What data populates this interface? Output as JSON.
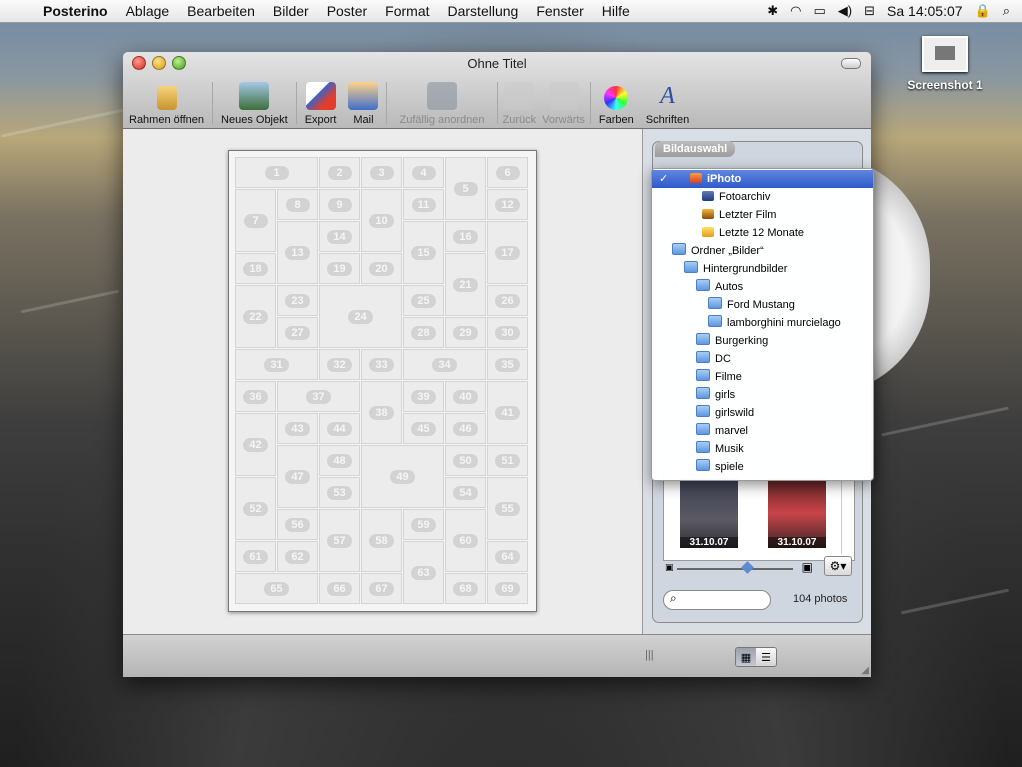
{
  "menubar": {
    "app": "Posterino",
    "items": [
      "Ablage",
      "Bearbeiten",
      "Bilder",
      "Poster",
      "Format",
      "Darstellung",
      "Fenster",
      "Hilfe"
    ],
    "clock": "Sa 14:05:07"
  },
  "desktop": {
    "icon_label": "Screenshot 1"
  },
  "window": {
    "title": "Ohne Titel",
    "toolbar": {
      "rahmen": "Rahmen öffnen",
      "neues_objekt": "Neues Objekt",
      "export": "Export",
      "mail": "Mail",
      "zufaellig": "Zufällig anordnen",
      "zurueck": "Zurück",
      "vorwaerts": "Vorwärts",
      "farben": "Farben",
      "schriften": "Schriften"
    },
    "poster_cells": [
      "1",
      "2",
      "3",
      "4",
      "5",
      "6",
      "7",
      "8",
      "9",
      "10",
      "11",
      "12",
      "13",
      "14",
      "15",
      "16",
      "17",
      "18",
      "19",
      "20",
      "21",
      "22",
      "23",
      "24",
      "25",
      "26",
      "27",
      "28",
      "29",
      "30",
      "31",
      "32",
      "33",
      "34",
      "35",
      "36",
      "37",
      "38",
      "39",
      "40",
      "41",
      "42",
      "43",
      "44",
      "45",
      "46",
      "47",
      "48",
      "49",
      "50",
      "51",
      "52",
      "53",
      "54",
      "55",
      "56",
      "57",
      "58",
      "59",
      "60",
      "61",
      "62",
      "63",
      "64",
      "65",
      "66",
      "67",
      "68",
      "69"
    ]
  },
  "sidebar": {
    "label": "Bildauswahl",
    "photo_dates": [
      "31.10.07",
      "31.10.07"
    ],
    "photo_count": "104 photos"
  },
  "popup": {
    "items": [
      {
        "label": "iPhoto",
        "icon": "iphoto-icon",
        "selected": true
      },
      {
        "label": "Fotoarchiv",
        "icon": "archive-icon"
      },
      {
        "label": "Letzter Film",
        "icon": "film-icon"
      },
      {
        "label": "Letzte 12 Monate",
        "icon": "calendar-icon"
      },
      {
        "label": "Ordner „Bilder“",
        "icon": "folder-icon"
      },
      {
        "label": "Hintergrundbilder",
        "icon": "folder-icon"
      },
      {
        "label": "Autos",
        "icon": "folder-icon"
      },
      {
        "label": "Ford Mustang",
        "icon": "folder-icon"
      },
      {
        "label": "lamborghini murcielago",
        "icon": "folder-icon"
      },
      {
        "label": "Burgerking",
        "icon": "folder-icon"
      },
      {
        "label": "DC",
        "icon": "folder-icon"
      },
      {
        "label": "Filme",
        "icon": "folder-icon"
      },
      {
        "label": "girls",
        "icon": "folder-icon"
      },
      {
        "label": "girlswild",
        "icon": "folder-icon"
      },
      {
        "label": "marvel",
        "icon": "folder-icon"
      },
      {
        "label": "Musik",
        "icon": "folder-icon"
      },
      {
        "label": "spiele",
        "icon": "folder-icon"
      }
    ]
  }
}
